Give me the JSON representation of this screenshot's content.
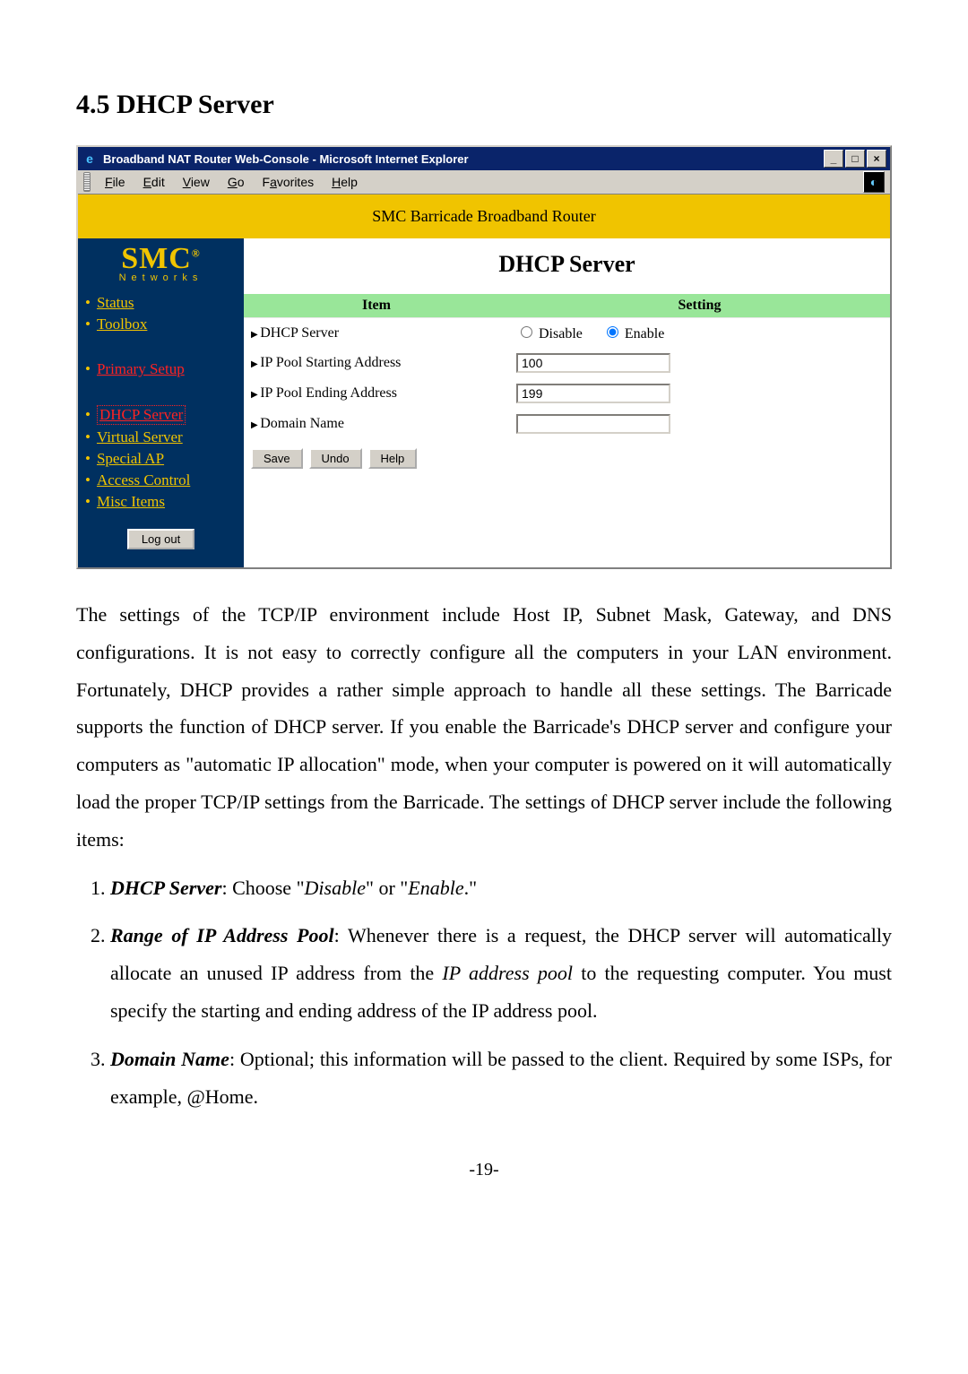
{
  "section": {
    "heading": "4.5 DHCP Server"
  },
  "window": {
    "title": "Broadband NAT Router Web-Console - Microsoft Internet Explorer",
    "menus": {
      "file": "File",
      "edit": "Edit",
      "view": "View",
      "go": "Go",
      "favorites": "Favorites",
      "help": "Help"
    }
  },
  "router": {
    "banner": "SMC Barricade Broadband Router",
    "logo_main": "SMC",
    "logo_sub": "Networks",
    "nav": {
      "status": "Status",
      "toolbox": "Toolbox",
      "primary_setup": "Primary Setup",
      "dhcp_server": "DHCP Server",
      "virtual_server": "Virtual Server",
      "special_ap": "Special AP",
      "access_control": "Access Control",
      "misc_items": "Misc Items"
    },
    "logout_label": "Log out",
    "content_title": "DHCP Server",
    "table": {
      "header_item": "Item",
      "header_setting": "Setting",
      "rows": {
        "dhcp_server": {
          "item": "DHCP Server",
          "disable_label": "Disable",
          "enable_label": "Enable",
          "selected": "Enable"
        },
        "ip_start": {
          "item": "IP Pool Starting Address",
          "value": "100"
        },
        "ip_end": {
          "item": "IP Pool Ending Address",
          "value": "199"
        },
        "domain": {
          "item": "Domain Name",
          "value": ""
        }
      }
    },
    "actions": {
      "save": "Save",
      "undo": "Undo",
      "help": "Help"
    }
  },
  "doc": {
    "paragraph": "The settings of the TCP/IP environment include Host IP, Subnet Mask, Gateway, and DNS configurations. It is not easy to correctly configure all the computers in your LAN environment. Fortunately, DHCP provides a rather simple approach to handle all these settings. The Barricade supports the function of DHCP server. If you enable the Barricade's DHCP server and configure your computers as \"automatic IP allocation\" mode, when your computer is powered on it will automatically load the proper TCP/IP settings from the Barricade. The settings of DHCP server include the following items:",
    "list": {
      "i1_term": "DHCP Server",
      "i1_rest": ": Choose \"",
      "i1_em1": "Disable",
      "i1_mid": "\" or \"",
      "i1_em2": "Enable",
      "i1_tail": ".\"",
      "i2_term": "Range of IP Address Pool",
      "i2_rest": ": Whenever there is a request, the DHCP server will automatically allocate an unused IP address from the ",
      "i2_em": "IP address pool",
      "i2_tail": " to the requesting computer. You must specify the starting and ending address of the IP address pool.",
      "i3_term": "Domain Name",
      "i3_rest": ": Optional; this information will be passed to the client. Required by some ISPs, for example, @Home."
    },
    "page_number": "-19-"
  }
}
